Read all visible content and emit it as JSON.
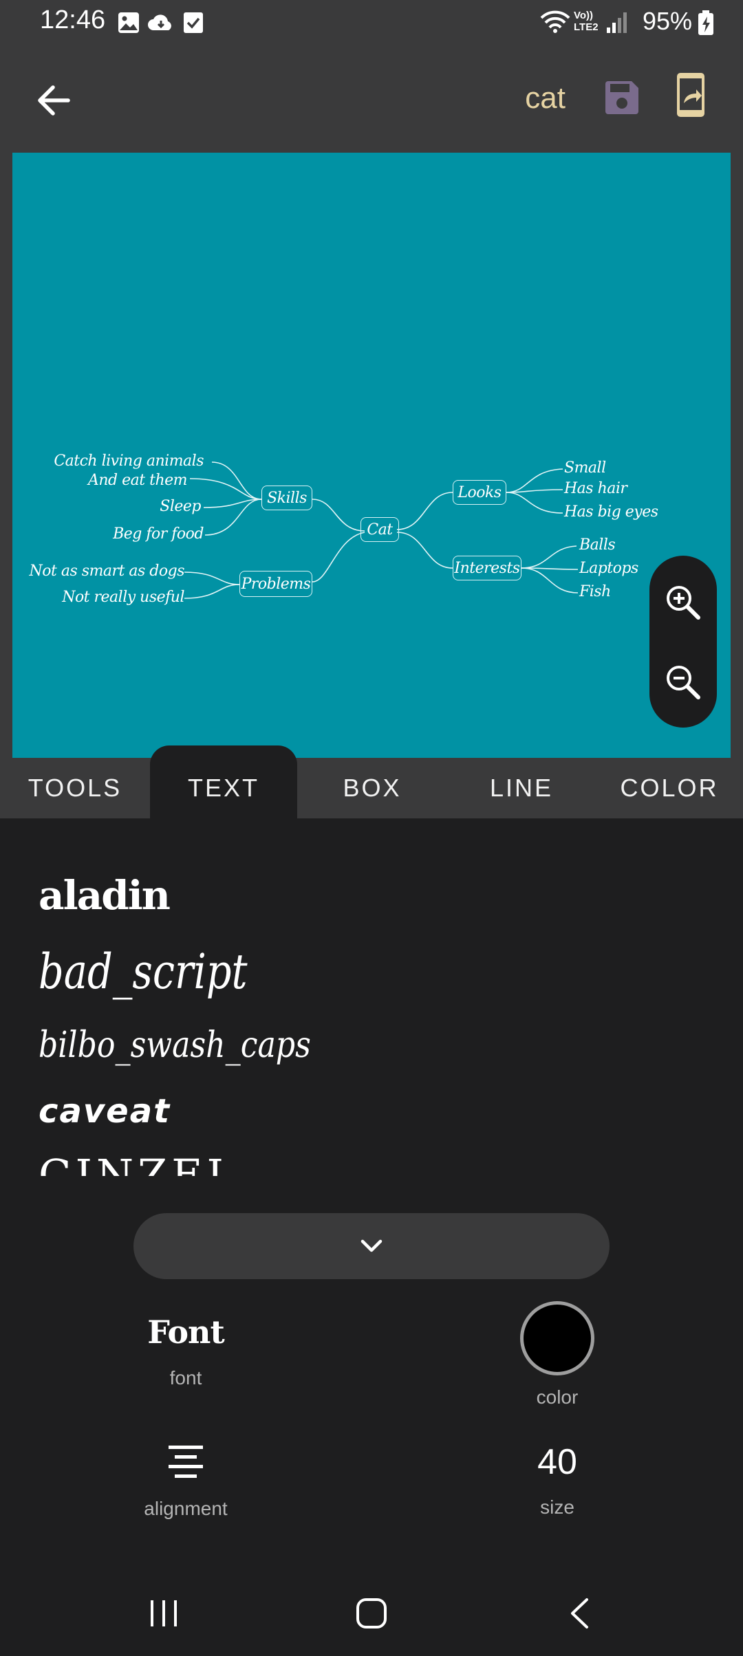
{
  "status_bar": {
    "time": "12:46",
    "network_label": "Vo)) LTE2",
    "battery": "95%"
  },
  "app_bar": {
    "title": "cat",
    "icons": [
      "back-arrow-icon",
      "save-icon",
      "share-icon"
    ]
  },
  "mindmap": {
    "background": "#0192a4",
    "root": "Cat",
    "branches": {
      "skills": {
        "label": "Skills",
        "items": [
          "Catch living animals",
          "And eat them",
          "Sleep",
          "Beg for food"
        ]
      },
      "problems": {
        "label": "Problems",
        "items": [
          "Not as smart as dogs",
          "Not really useful"
        ]
      },
      "looks": {
        "label": "Looks",
        "items": [
          "Small",
          "Has hair",
          "Has big eyes"
        ]
      },
      "interests": {
        "label": "Interests",
        "items": [
          "Balls",
          "Laptops",
          "Fish"
        ]
      }
    }
  },
  "tabs": [
    {
      "label": "TOOLS",
      "active": false
    },
    {
      "label": "TEXT",
      "active": true
    },
    {
      "label": "BOX",
      "active": false
    },
    {
      "label": "LINE",
      "active": false
    },
    {
      "label": "COLOR",
      "active": false
    }
  ],
  "fonts": [
    "aladin",
    "bad_script",
    "bilbo_swash_caps",
    "caveat",
    "CINZEL"
  ],
  "properties": {
    "font": {
      "sample": "Font",
      "label": "font"
    },
    "color": {
      "label": "color",
      "value": "#000000"
    },
    "alignment": {
      "label": "alignment"
    },
    "size": {
      "label": "size",
      "value": "40"
    }
  },
  "colors": {
    "bar": "#3a3a3b",
    "panel": "#1e1e1f",
    "title_accent": "#e6d3a3",
    "save_icon": "#7a6b8c"
  }
}
